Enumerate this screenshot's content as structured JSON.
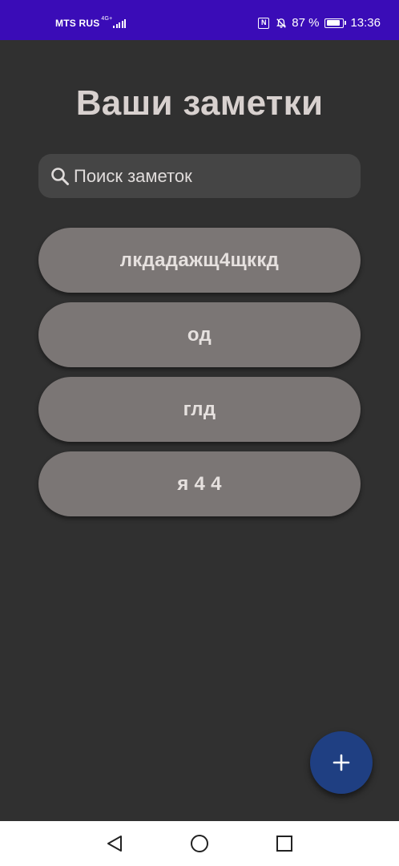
{
  "status_bar": {
    "carrier": "MTS RUS",
    "network": "4G+",
    "battery_percent": "87 %",
    "battery_level": 0.87,
    "time": "13:36",
    "icons": [
      "nfc-icon",
      "bell-off-icon",
      "battery-charging-icon",
      "signal-icon"
    ]
  },
  "page": {
    "title": "Ваши заметки"
  },
  "search": {
    "placeholder": "Поиск заметок",
    "value": "",
    "icon": "search-icon"
  },
  "notes": [
    {
      "title": "лкдадажщ4щккд"
    },
    {
      "title": "од"
    },
    {
      "title": "глд"
    },
    {
      "title": "я 4 4"
    }
  ],
  "fab": {
    "icon": "plus-icon"
  },
  "nav_bar": {
    "buttons": [
      "back-icon",
      "home-icon",
      "recent-apps-icon"
    ]
  },
  "colors": {
    "status_bar": "#3a0cb7",
    "background": "#303030",
    "title": "#d8d1cf",
    "search_bg": "#454545",
    "note_bg": "#7b7675",
    "fab_bg": "#1f3f82"
  }
}
